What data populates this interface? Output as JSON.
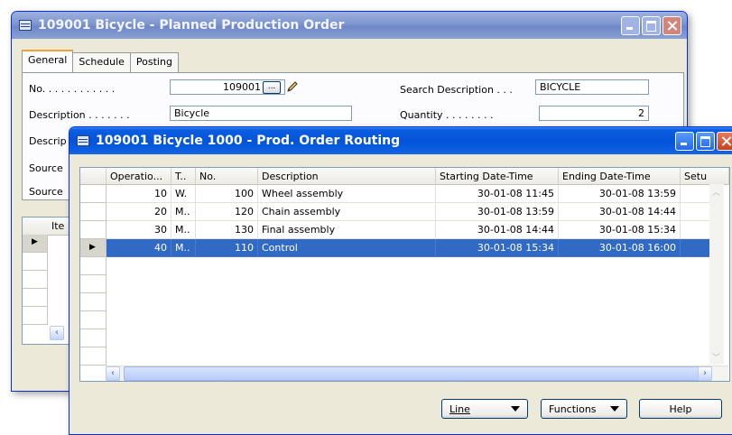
{
  "back_window": {
    "title": "109001 Bicycle - Planned Production Order",
    "tabs": [
      {
        "label": "General"
      },
      {
        "label": "Schedule"
      },
      {
        "label": "Posting"
      }
    ],
    "fields": {
      "no_label": "No. . . . . . . . . . . .",
      "no_value": "109001",
      "ellipsis": "...",
      "search_desc_label": "Search Description . . .",
      "search_desc_value": "BICYCLE",
      "description_label": "Description . . . . . . .",
      "description_value": "Bicycle",
      "quantity_label": "Quantity . . . . . . . .",
      "quantity_value": "2",
      "desc2_label": "Descrip",
      "source1_label": "Source",
      "source2_label": "Source"
    },
    "lines_header": "Ite"
  },
  "front_window": {
    "title": "109001 Bicycle 1000 - Prod. Order Routing",
    "columns": [
      "Operatio...",
      "T..",
      "No.",
      "Description",
      "Starting Date-Time",
      "Ending Date-Time",
      "Setu"
    ],
    "rows": [
      {
        "op": "10",
        "type": "W.",
        "no": "100",
        "desc": "Wheel assembly",
        "start": "30-01-08 11:45",
        "end": "30-01-08 13:59"
      },
      {
        "op": "20",
        "type": "M..",
        "no": "120",
        "desc": "Chain assembly",
        "start": "30-01-08 13:59",
        "end": "30-01-08 14:44"
      },
      {
        "op": "30",
        "type": "M..",
        "no": "130",
        "desc": "Final assembly",
        "start": "30-01-08 14:44",
        "end": "30-01-08 15:34"
      },
      {
        "op": "40",
        "type": "M..",
        "no": "110",
        "desc": "Control",
        "start": "30-01-08 15:34",
        "end": "30-01-08 16:00"
      }
    ],
    "buttons": {
      "line": "Line",
      "functions": "Functions",
      "help": "Help"
    }
  }
}
